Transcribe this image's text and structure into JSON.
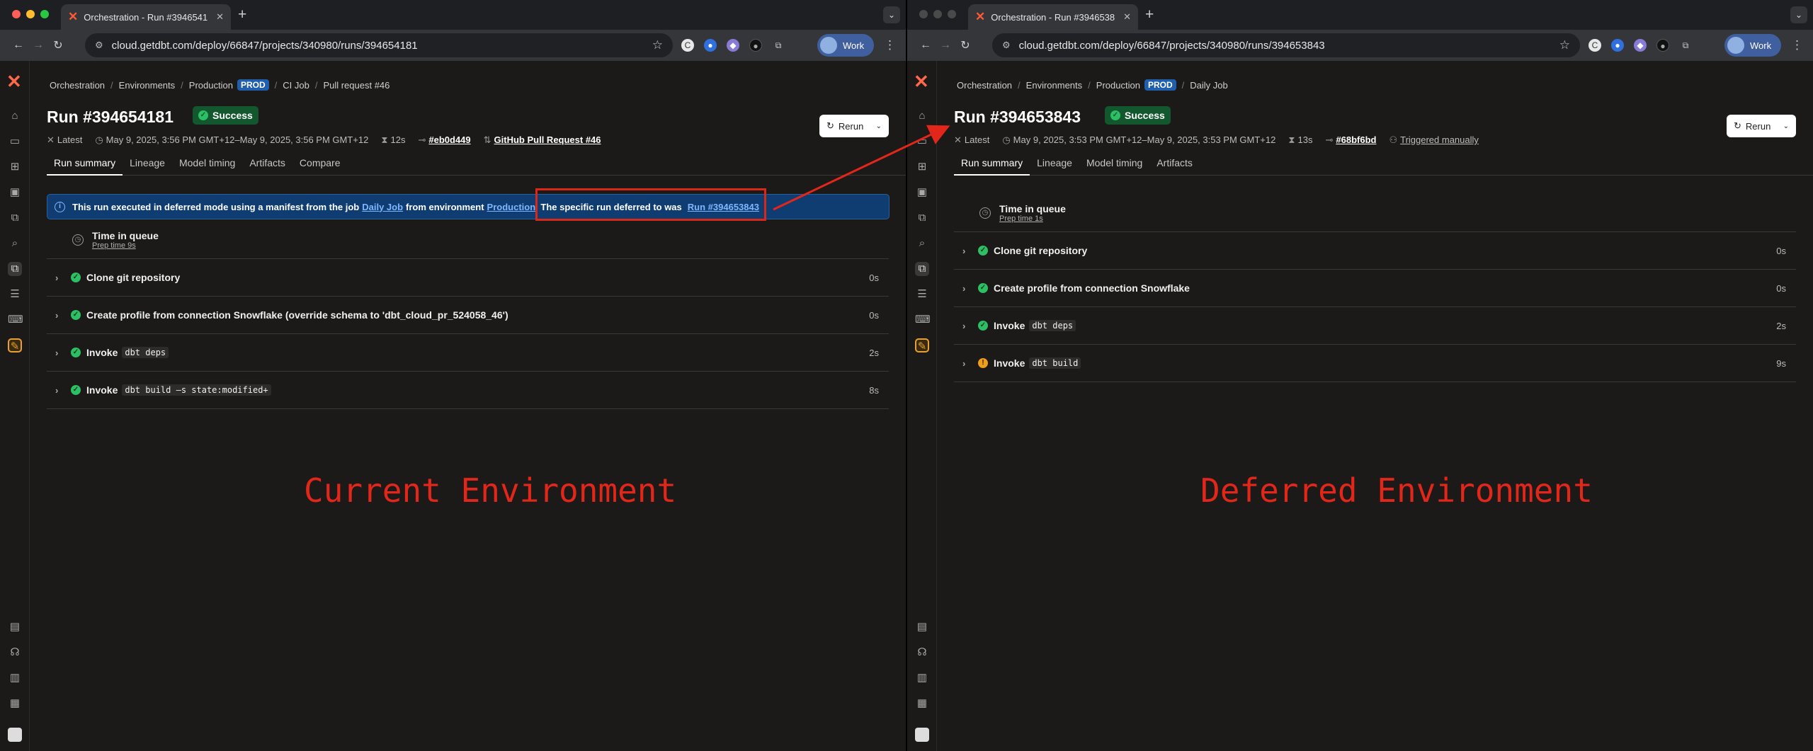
{
  "left": {
    "tab_title": "Orchestration - Run #3946541",
    "url": "cloud.getdbt.com/deploy/66847/projects/340980/runs/394654181",
    "profile_label": "Work",
    "breadcrumb": [
      "Orchestration",
      "Environments",
      "Production",
      "CI Job",
      "Pull request #46"
    ],
    "env_badge": "PROD",
    "run_title": "Run #394654181",
    "status": "Success",
    "meta": {
      "latest": "Latest",
      "time": "May 9, 2025, 3:56 PM GMT+12–May 9, 2025, 3:56 PM GMT+12",
      "duration": "12s",
      "commit": "#eb0d449",
      "trigger": "GitHub Pull Request #46"
    },
    "rerun_label": "Rerun",
    "tabs": [
      "Run summary",
      "Lineage",
      "Model timing",
      "Artifacts",
      "Compare"
    ],
    "banner": {
      "text1": "This run executed in deferred mode using a manifest from the job",
      "job_link": "Daily Job",
      "text2": "from environment",
      "env_link": "Production",
      "text3": ". The specific run deferred to was",
      "run_link": "Run #394653843"
    },
    "queue": {
      "label": "Time in queue",
      "prep": "Prep time 9s"
    },
    "steps": [
      {
        "label": "Clone git repository",
        "code": "",
        "duration": "0s",
        "status": "success"
      },
      {
        "label": "Create profile from connection Snowflake (override schema to 'dbt_cloud_pr_524058_46')",
        "code": "",
        "duration": "0s",
        "status": "success"
      },
      {
        "label": "Invoke",
        "code": "dbt deps",
        "duration": "2s",
        "status": "success"
      },
      {
        "label": "Invoke",
        "code": "dbt build —s state:modified+",
        "duration": "8s",
        "status": "success"
      }
    ],
    "annotation": "Current Environment"
  },
  "right": {
    "tab_title": "Orchestration - Run #3946538",
    "url": "cloud.getdbt.com/deploy/66847/projects/340980/runs/394653843",
    "profile_label": "Work",
    "breadcrumb": [
      "Orchestration",
      "Environments",
      "Production",
      "Daily Job"
    ],
    "env_badge": "PROD",
    "run_title": "Run #394653843",
    "status": "Success",
    "meta": {
      "latest": "Latest",
      "time": "May 9, 2025, 3:53 PM GMT+12–May 9, 2025, 3:53 PM GMT+12",
      "duration": "13s",
      "commit": "#68bf6bd",
      "trigger": "Triggered manually"
    },
    "rerun_label": "Rerun",
    "tabs": [
      "Run summary",
      "Lineage",
      "Model timing",
      "Artifacts"
    ],
    "queue": {
      "label": "Time in queue",
      "prep": "Prep time 1s"
    },
    "steps": [
      {
        "label": "Clone git repository",
        "code": "",
        "duration": "0s",
        "status": "success"
      },
      {
        "label": "Create profile from connection Snowflake",
        "code": "",
        "duration": "0s",
        "status": "success"
      },
      {
        "label": "Invoke",
        "code": "dbt deps",
        "duration": "2s",
        "status": "success"
      },
      {
        "label": "Invoke",
        "code": "dbt build",
        "duration": "9s",
        "status": "warning"
      }
    ],
    "annotation": "Deferred Environment"
  },
  "colors": {
    "accent": "#ff694a",
    "success": "#2dbf63",
    "warning": "#f0a018",
    "annotation": "#e2261a",
    "prod_badge": "#1f5fae"
  }
}
